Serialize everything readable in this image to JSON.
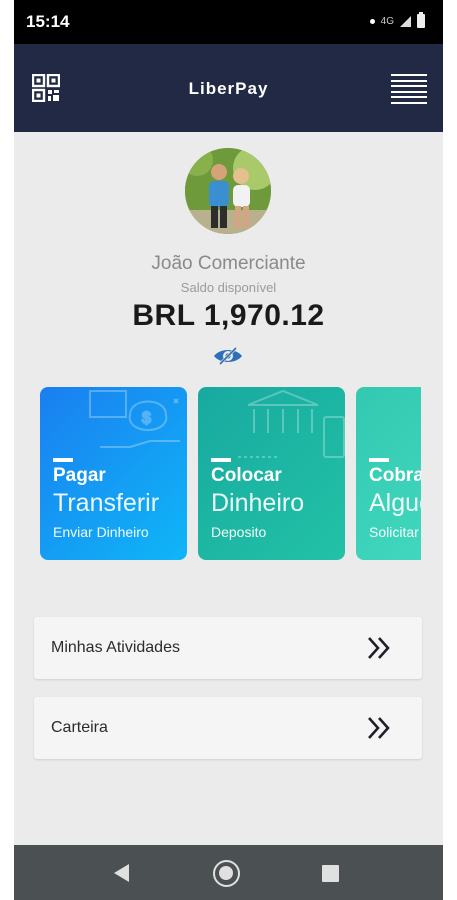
{
  "status_bar": {
    "time": "15:14",
    "network": "4G"
  },
  "app_bar": {
    "title": "LiberPay",
    "qr_icon": "qr-code-icon",
    "menu_icon": "hamburger-menu-icon"
  },
  "profile": {
    "name": "João Comerciante",
    "balance_label": "Saldo disponível",
    "balance": "BRL 1,970.12",
    "visibility_icon": "eye-hidden-icon"
  },
  "cards": [
    {
      "title": "Pagar",
      "action": "Transferir",
      "subtitle": "Enviar Dinheiro",
      "color_start": "#1a7ff0",
      "color_end": "#0fb6f7"
    },
    {
      "title": "Colocar",
      "action": "Dinheiro",
      "subtitle": "Deposito",
      "color_start": "#18a9a0",
      "color_end": "#22c2a6"
    },
    {
      "title": "Cobrar",
      "action": "Alguém",
      "subtitle": "Solicitar",
      "color_start": "#33c9b0",
      "color_end": "#45dcc3"
    }
  ],
  "menu_items": [
    {
      "label": "Minhas Atividades",
      "icon": "double-chevron-right-icon"
    },
    {
      "label": "Carteira",
      "icon": "double-chevron-right-icon"
    }
  ],
  "colors": {
    "app_bar": "#212944",
    "background": "#ebebeb",
    "nav_bar": "#4b5153"
  }
}
